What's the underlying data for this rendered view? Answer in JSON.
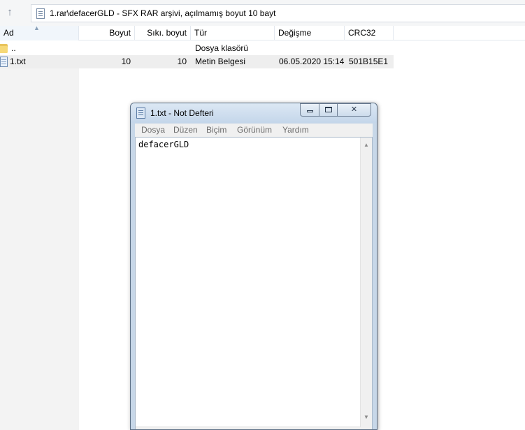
{
  "address": {
    "path": "1.rar\\defacerGLD - SFX RAR arşivi, açılmamış boyut 10 bayt",
    "up_icon": "up-arrow-icon",
    "archive_icon": "archive-file-icon"
  },
  "columns": [
    {
      "key": "name",
      "label": "Ad"
    },
    {
      "key": "size",
      "label": "Boyut"
    },
    {
      "key": "packed",
      "label": "Sıkı. boyut"
    },
    {
      "key": "type",
      "label": "Tür"
    },
    {
      "key": "modified",
      "label": "Değişme"
    },
    {
      "key": "crc",
      "label": "CRC32"
    }
  ],
  "files": [
    {
      "name": "..",
      "size": "",
      "packed": "",
      "type": "Dosya klasörü",
      "modified": "",
      "crc": "",
      "icon": "folder-icon"
    },
    {
      "name": "1.txt",
      "size": "10",
      "packed": "10",
      "type": "Metin Belgesi",
      "modified": "06.05.2020 15:14",
      "crc": "501B15E1",
      "icon": "text-file-icon",
      "selected": true
    }
  ],
  "notepad": {
    "title": "1.txt - Not Defteri",
    "menu": [
      "Dosya",
      "Düzen",
      "Biçim",
      "Görünüm",
      "Yardım"
    ],
    "content": "defacerGLD",
    "minimize_glyph": "",
    "maximize_glyph": "",
    "close_glyph": "✕",
    "colors": {
      "frame": "#c7d7e8",
      "close_hover": "#c75050"
    }
  },
  "colors": {
    "selected_row": "#eeeeee",
    "header_sorted": "#f1f6fb"
  }
}
